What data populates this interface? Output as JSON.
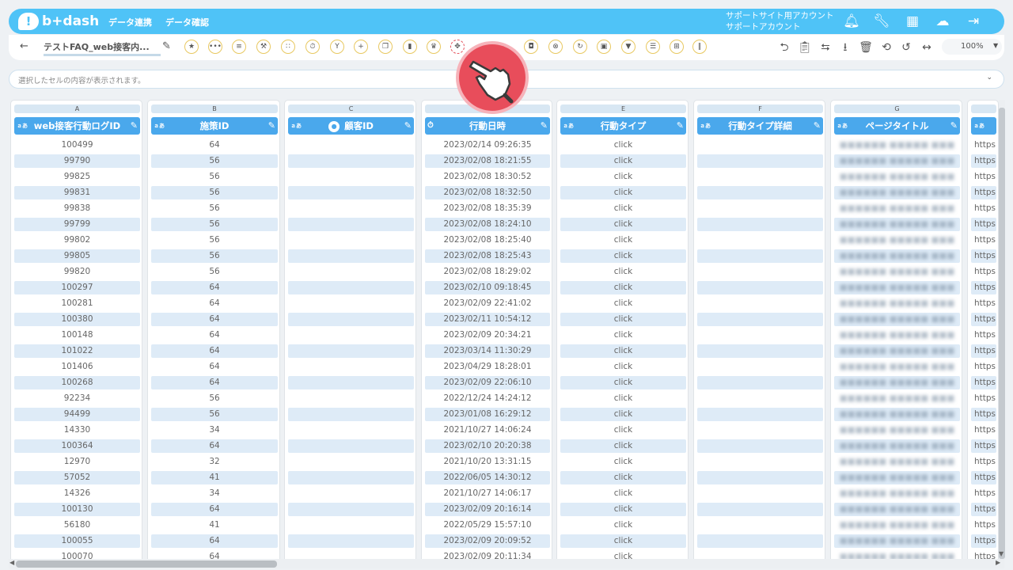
{
  "app": {
    "logo_text": "b+dash",
    "nav": [
      "データ連携",
      "データ確認"
    ],
    "account_line1": "サポートサイト用アカウント",
    "account_line2": "サポートアカウント"
  },
  "toolbar": {
    "back_label": "←",
    "sheet_name": "テストFAQ_web接客内...",
    "zoom": "100%"
  },
  "formula_bar": {
    "placeholder": "選択したセルの内容が表示されます。"
  },
  "columns": [
    {
      "letter": "A",
      "title": "web接客行動ログID",
      "type_badge": "ａあ"
    },
    {
      "letter": "B",
      "title": "施策ID",
      "type_badge": "ａあ"
    },
    {
      "letter": "C",
      "title": "顧客ID",
      "type_badge": "ａあ"
    },
    {
      "letter": "",
      "title": "行動日時",
      "type_badge": ""
    },
    {
      "letter": "E",
      "title": "行動タイプ",
      "type_badge": "ａあ"
    },
    {
      "letter": "F",
      "title": "行動タイプ詳細",
      "type_badge": "ａあ"
    },
    {
      "letter": "G",
      "title": "ページタイトル",
      "type_badge": "ａあ"
    },
    {
      "letter": "",
      "title": "",
      "type_badge": "ａあ"
    }
  ],
  "rows": [
    {
      "a": "100499",
      "b": "64",
      "d": "2023/02/14 09:26:35",
      "e": "click",
      "h": "https"
    },
    {
      "a": "99790",
      "b": "56",
      "d": "2023/02/08 18:21:55",
      "e": "click",
      "h": "https"
    },
    {
      "a": "99825",
      "b": "56",
      "d": "2023/02/08 18:30:52",
      "e": "click",
      "h": "https"
    },
    {
      "a": "99831",
      "b": "56",
      "d": "2023/02/08 18:32:50",
      "e": "click",
      "h": "https"
    },
    {
      "a": "99838",
      "b": "56",
      "d": "2023/02/08 18:35:39",
      "e": "click",
      "h": "https"
    },
    {
      "a": "99799",
      "b": "56",
      "d": "2023/02/08 18:24:10",
      "e": "click",
      "h": "https"
    },
    {
      "a": "99802",
      "b": "56",
      "d": "2023/02/08 18:25:40",
      "e": "click",
      "h": "https"
    },
    {
      "a": "99805",
      "b": "56",
      "d": "2023/02/08 18:25:43",
      "e": "click",
      "h": "https"
    },
    {
      "a": "99820",
      "b": "56",
      "d": "2023/02/08 18:29:02",
      "e": "click",
      "h": "https"
    },
    {
      "a": "100297",
      "b": "64",
      "d": "2023/02/10 09:18:45",
      "e": "click",
      "h": "https"
    },
    {
      "a": "100281",
      "b": "64",
      "d": "2023/02/09 22:41:02",
      "e": "click",
      "h": "https"
    },
    {
      "a": "100380",
      "b": "64",
      "d": "2023/02/11 10:54:12",
      "e": "click",
      "h": "https"
    },
    {
      "a": "100148",
      "b": "64",
      "d": "2023/02/09 20:34:21",
      "e": "click",
      "h": "https"
    },
    {
      "a": "101022",
      "b": "64",
      "d": "2023/03/14 11:30:29",
      "e": "click",
      "h": "https"
    },
    {
      "a": "101406",
      "b": "64",
      "d": "2023/04/29 18:28:01",
      "e": "click",
      "h": "https"
    },
    {
      "a": "100268",
      "b": "64",
      "d": "2023/02/09 22:06:10",
      "e": "click",
      "h": "https"
    },
    {
      "a": "92234",
      "b": "56",
      "d": "2022/12/24 14:24:12",
      "e": "click",
      "h": "https"
    },
    {
      "a": "94499",
      "b": "56",
      "d": "2023/01/08 16:29:12",
      "e": "click",
      "h": "https"
    },
    {
      "a": "14330",
      "b": "34",
      "d": "2021/10/27 14:06:24",
      "e": "click",
      "h": "https"
    },
    {
      "a": "100364",
      "b": "64",
      "d": "2023/02/10 20:20:38",
      "e": "click",
      "h": "https"
    },
    {
      "a": "12970",
      "b": "32",
      "d": "2021/10/20 13:31:15",
      "e": "click",
      "h": "https"
    },
    {
      "a": "57052",
      "b": "41",
      "d": "2022/06/05 14:30:12",
      "e": "click",
      "h": "https"
    },
    {
      "a": "14326",
      "b": "34",
      "d": "2021/10/27 14:06:17",
      "e": "click",
      "h": "https"
    },
    {
      "a": "100130",
      "b": "64",
      "d": "2023/02/09 20:16:14",
      "e": "click",
      "h": "https"
    },
    {
      "a": "56180",
      "b": "41",
      "d": "2022/05/29 15:57:10",
      "e": "click",
      "h": "https"
    },
    {
      "a": "100055",
      "b": "64",
      "d": "2023/02/09 20:09:52",
      "e": "click",
      "h": "https"
    },
    {
      "a": "100070",
      "b": "64",
      "d": "2023/02/09 20:11:34",
      "e": "click",
      "h": "https"
    }
  ],
  "colors": {
    "brand": "#4fc3f7",
    "header": "#4aa8ec",
    "stripe": "#deebf7",
    "highlight": "#e84d5b"
  }
}
